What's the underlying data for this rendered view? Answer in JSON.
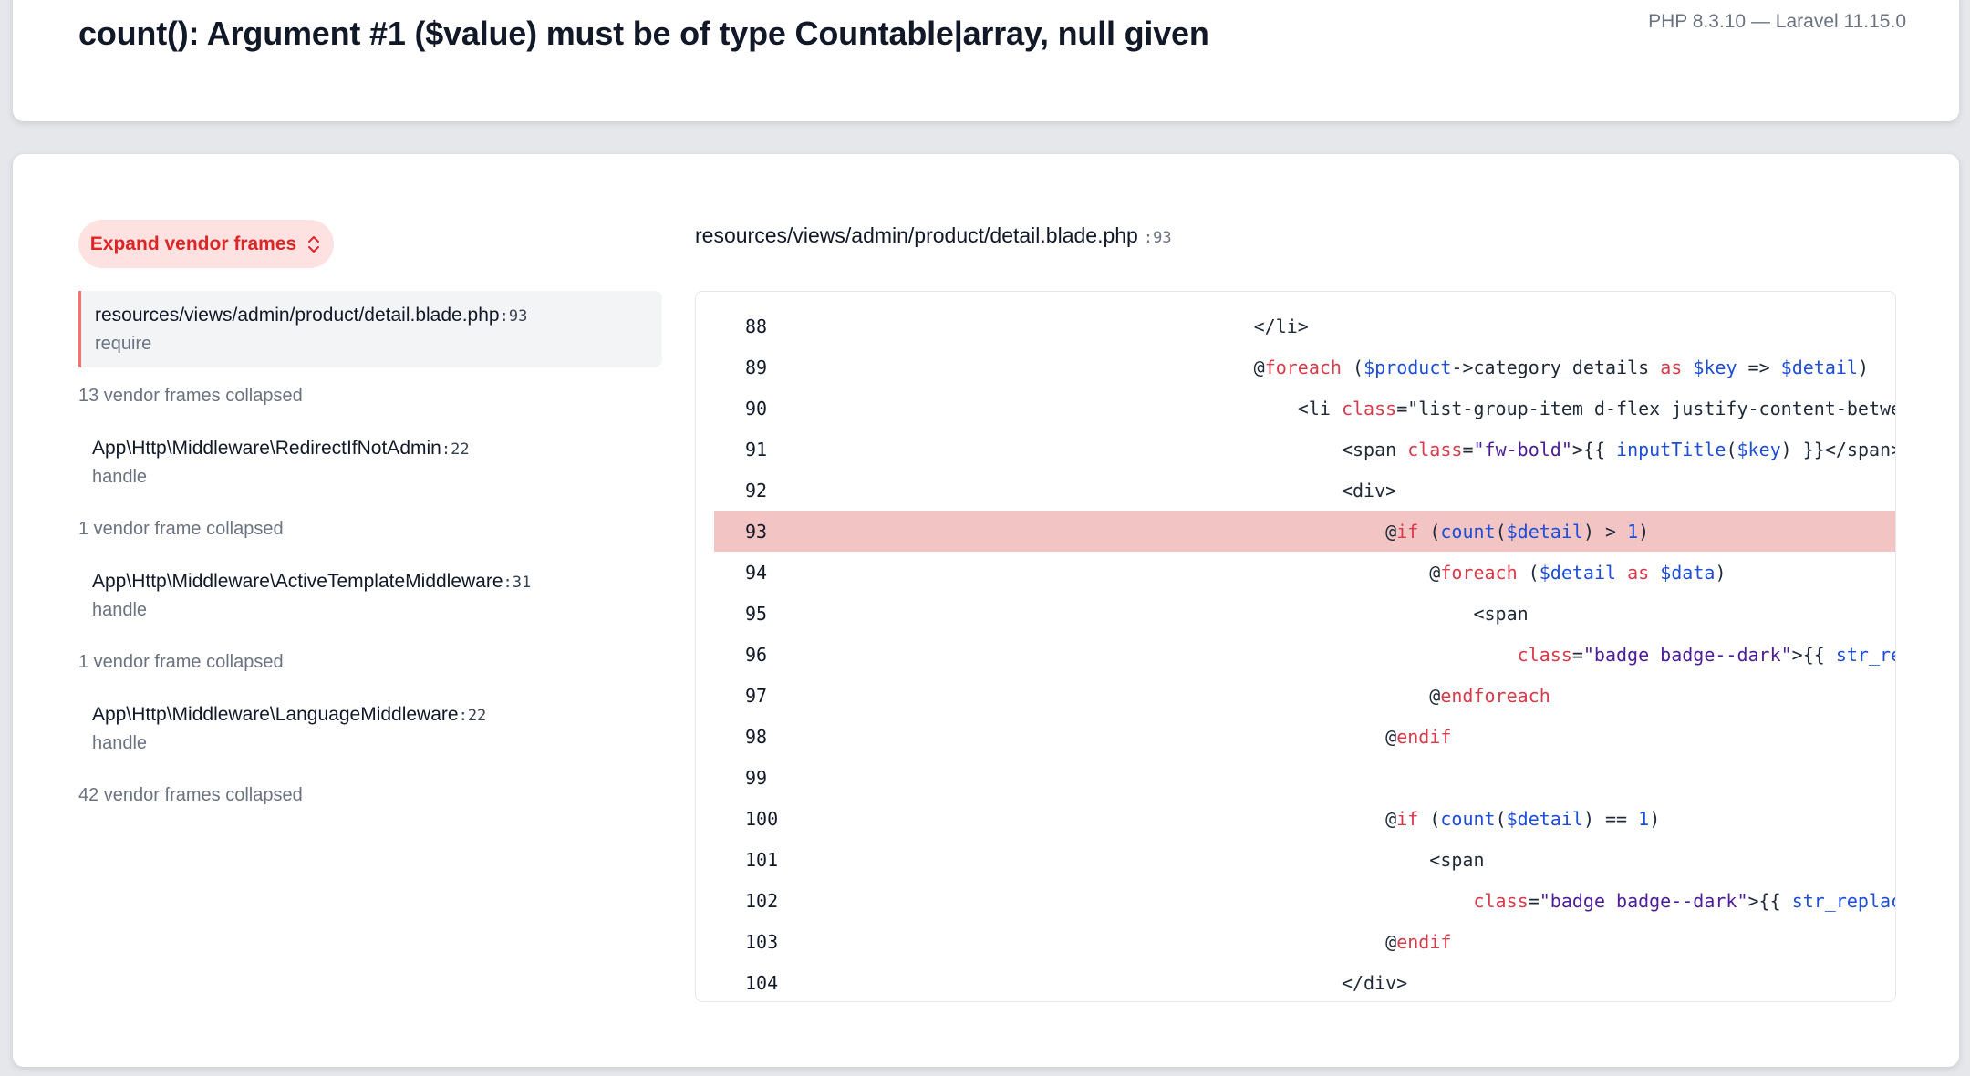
{
  "header": {
    "title": "count(): Argument #1 ($value) must be of type Countable|array, null given",
    "version": "PHP 8.3.10 — Laravel 11.15.0"
  },
  "sidebar": {
    "expand_button_label": "Expand vendor frames",
    "active_frame": {
      "file": "resources/views/admin/product/detail.blade.php",
      "line": ":93",
      "func": "require"
    },
    "entries": [
      {
        "collapsed": "13 vendor frames collapsed"
      },
      {
        "file": "App\\Http\\Middleware\\RedirectIfNotAdmin",
        "line": ":22",
        "func": "handle"
      },
      {
        "collapsed": "1 vendor frame collapsed"
      },
      {
        "file": "App\\Http\\Middleware\\ActiveTemplateMiddleware",
        "line": ":31",
        "func": "handle"
      },
      {
        "collapsed": "1 vendor frame collapsed"
      },
      {
        "file": "App\\Http\\Middleware\\LanguageMiddleware",
        "line": ":22",
        "func": "handle"
      },
      {
        "collapsed": "42 vendor frames collapsed"
      }
    ]
  },
  "code": {
    "path": "resources/views/admin/product/detail.blade.php",
    "path_line": ":93",
    "highlight_line": 93,
    "lines": [
      {
        "num": "88",
        "text": "                                        </li>"
      },
      {
        "num": "89",
        "text": "                                        @foreach ($product->category_details as $key => $detail)"
      },
      {
        "num": "90",
        "text": "                                            <li class=\"list-group-item d-flex justify-content-between align-item"
      },
      {
        "num": "91",
        "text": "                                                <span class=\"fw-bold\">{{ inputTitle($key) }}</span>"
      },
      {
        "num": "92",
        "text": "                                                <div>"
      },
      {
        "num": "93",
        "text": "                                                    @if (count($detail) > 1)"
      },
      {
        "num": "94",
        "text": "                                                        @foreach ($detail as $data)"
      },
      {
        "num": "95",
        "text": "                                                            <span"
      },
      {
        "num": "96",
        "text": "                                                                class=\"badge badge--dark\">{{ str_replace('_', '"
      },
      {
        "num": "97",
        "text": "                                                        @endforeach"
      },
      {
        "num": "98",
        "text": "                                                    @endif"
      },
      {
        "num": "99",
        "text": ""
      },
      {
        "num": "100",
        "text": "                                                    @if (count($detail) == 1)"
      },
      {
        "num": "101",
        "text": "                                                        <span"
      },
      {
        "num": "102",
        "text": "                                                            class=\"badge badge--dark\">{{ str_replace('_', ' ', @"
      },
      {
        "num": "103",
        "text": "                                                    @endif"
      },
      {
        "num": "104",
        "text": "                                                </div>"
      }
    ]
  },
  "colors": {
    "accent": "#dc2626",
    "highlight": "#f3c4c4",
    "keyword": "#d73a49",
    "variable": "#1d4ed8"
  },
  "icons": {
    "expand": "chevron-up-down-icon"
  }
}
